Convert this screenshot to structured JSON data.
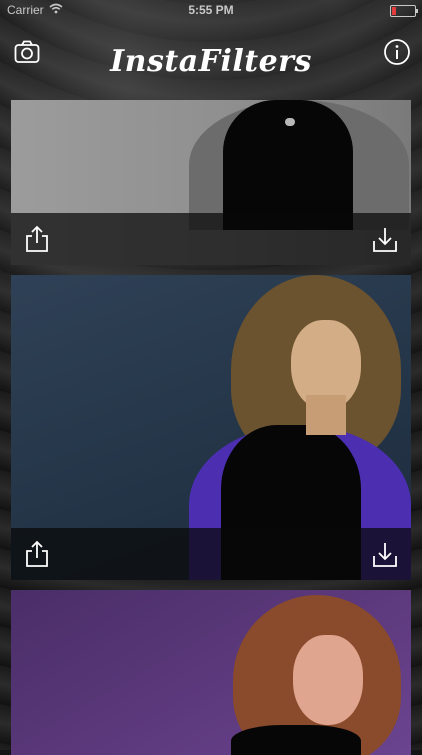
{
  "status": {
    "carrier": "Carrier",
    "time": "5:55 PM"
  },
  "header": {
    "title": "InstaFilters",
    "left_icon": "camera-icon",
    "right_icon": "info-icon"
  },
  "cards": [
    {
      "filter": "grayscale",
      "share_icon": "share-icon",
      "download_icon": "download-icon"
    },
    {
      "filter": "blue",
      "share_icon": "share-icon",
      "download_icon": "download-icon"
    },
    {
      "filter": "purple"
    }
  ]
}
